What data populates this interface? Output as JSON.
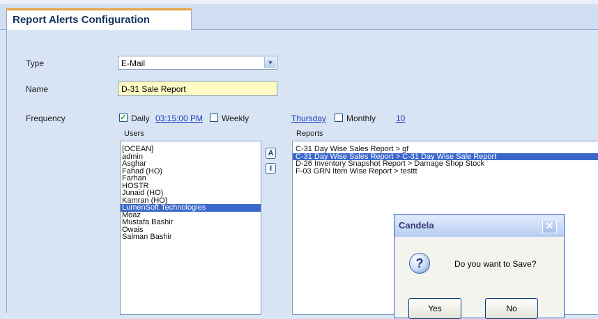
{
  "tab": {
    "title": "Report Alerts Configuration"
  },
  "form": {
    "type_label": "Type",
    "type_value": "E-Mail",
    "name_label": "Name",
    "name_value": "D-31 Sale Report",
    "frequency_label": "Frequency",
    "daily_label": "Daily",
    "daily_checked": true,
    "daily_time": "03:15:00 PM",
    "weekly_label": "Weekly",
    "weekly_checked": false,
    "weekly_day": "Thursday",
    "monthly_label": "Monthly",
    "monthly_checked": false,
    "monthly_day": "10"
  },
  "users": {
    "header": "Users",
    "items": [
      "[OCEAN]",
      "admin",
      "Asghar",
      "Fahad (HO)",
      "Farhan",
      "HOSTR",
      "Junaid (HO)",
      "Kamran (HO)",
      "LumenSoft Technologies",
      "Moaz",
      "Mustafa Bashir",
      "Owais",
      "Salman Bashir"
    ],
    "selected_index": 8
  },
  "buttons": {
    "all_label": "A",
    "individual_label": "I"
  },
  "reports": {
    "header": "Reports",
    "items": [
      "C-31  Day Wise Sales Report > gf",
      "C-31  Day Wise Sales Report > C-31 Day Wise Sale Report",
      "D-26  Inventory Snapshot Report > Damage Shop Stock",
      "F-03  GRN Item Wise Report > testtt"
    ],
    "selected_index": 1
  },
  "dialog": {
    "title": "Candela",
    "message": "Do you want to Save?",
    "yes_label": "Yes",
    "no_label": "No"
  },
  "colors": {
    "accent": "#e8a33b",
    "selection": "#3b67cc",
    "link": "#1d3fbf",
    "name_field_bg": "#fff9c4"
  }
}
